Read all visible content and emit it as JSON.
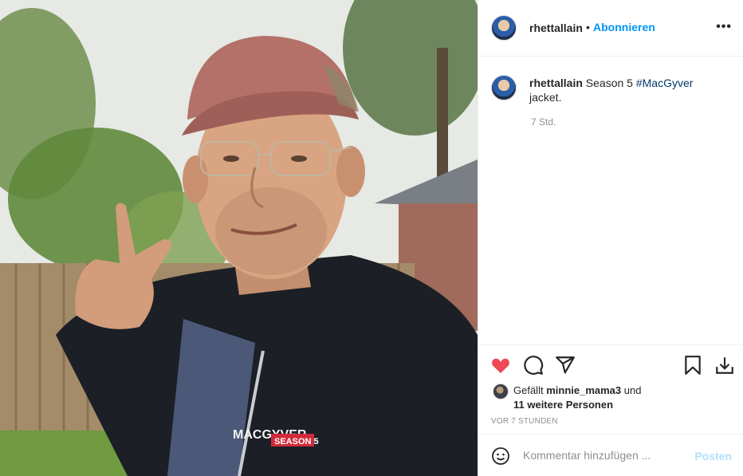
{
  "post": {
    "username": "rhettallain",
    "follow_separator": "•",
    "follow_label": "Abonnieren",
    "more_label": "•••",
    "caption_rest": "Season 5",
    "hashtag": "#MacGyver",
    "caption_end": "jacket.",
    "relative_time": "7 Std.",
    "liked_by_prefix": "Gefällt",
    "liked_by_user": "minnie_mama3",
    "liked_by_and": "und",
    "liked_by_others": "11 weitere Personen",
    "posted_ago": "VOR 7 STUNDEN",
    "comment_placeholder": "Kommentar hinzufügen ...",
    "post_button": "Posten",
    "like_state": "liked",
    "photo_jacket_text": "MACGYVER",
    "photo_jacket_subtext": "SEASON 5"
  },
  "icons": {
    "like": "heart-filled-icon",
    "comment": "speech-bubble-icon",
    "share": "paper-plane-icon",
    "save": "bookmark-icon",
    "download": "download-icon",
    "emoji": "smiley-icon",
    "more": "ellipsis-icon"
  },
  "colors": {
    "accent": "#0095f6",
    "like_red": "#ed4956",
    "hashtag": "#00376b",
    "muted": "#8e8e8e",
    "post_disabled": "#b2dffc"
  }
}
